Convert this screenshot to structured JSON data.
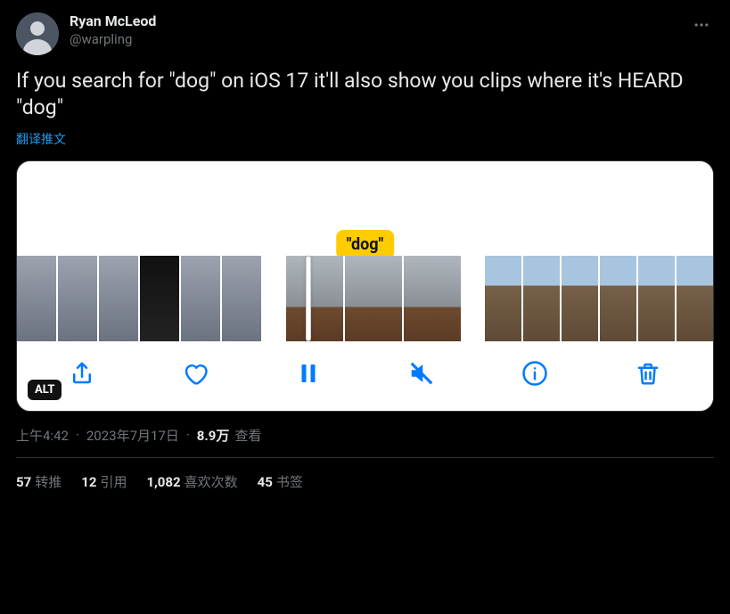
{
  "author": {
    "display_name": "Ryan McLeod",
    "handle": "@warpling"
  },
  "body": "If you search for \"dog\" on iOS 17 it'll also show you clips where it's HEARD \"dog\"",
  "translate_label": "翻译推文",
  "media": {
    "caption_label": "\"dog\"",
    "alt_badge": "ALT"
  },
  "meta": {
    "time": "上午4:42",
    "date": "2023年7月17日",
    "views_number": "8.9万",
    "views_label": "查看"
  },
  "stats": {
    "retweets": {
      "count": "57",
      "label": "转推"
    },
    "quotes": {
      "count": "12",
      "label": "引用"
    },
    "likes": {
      "count": "1,082",
      "label": "喜欢次数"
    },
    "bookmarks": {
      "count": "45",
      "label": "书签"
    }
  }
}
